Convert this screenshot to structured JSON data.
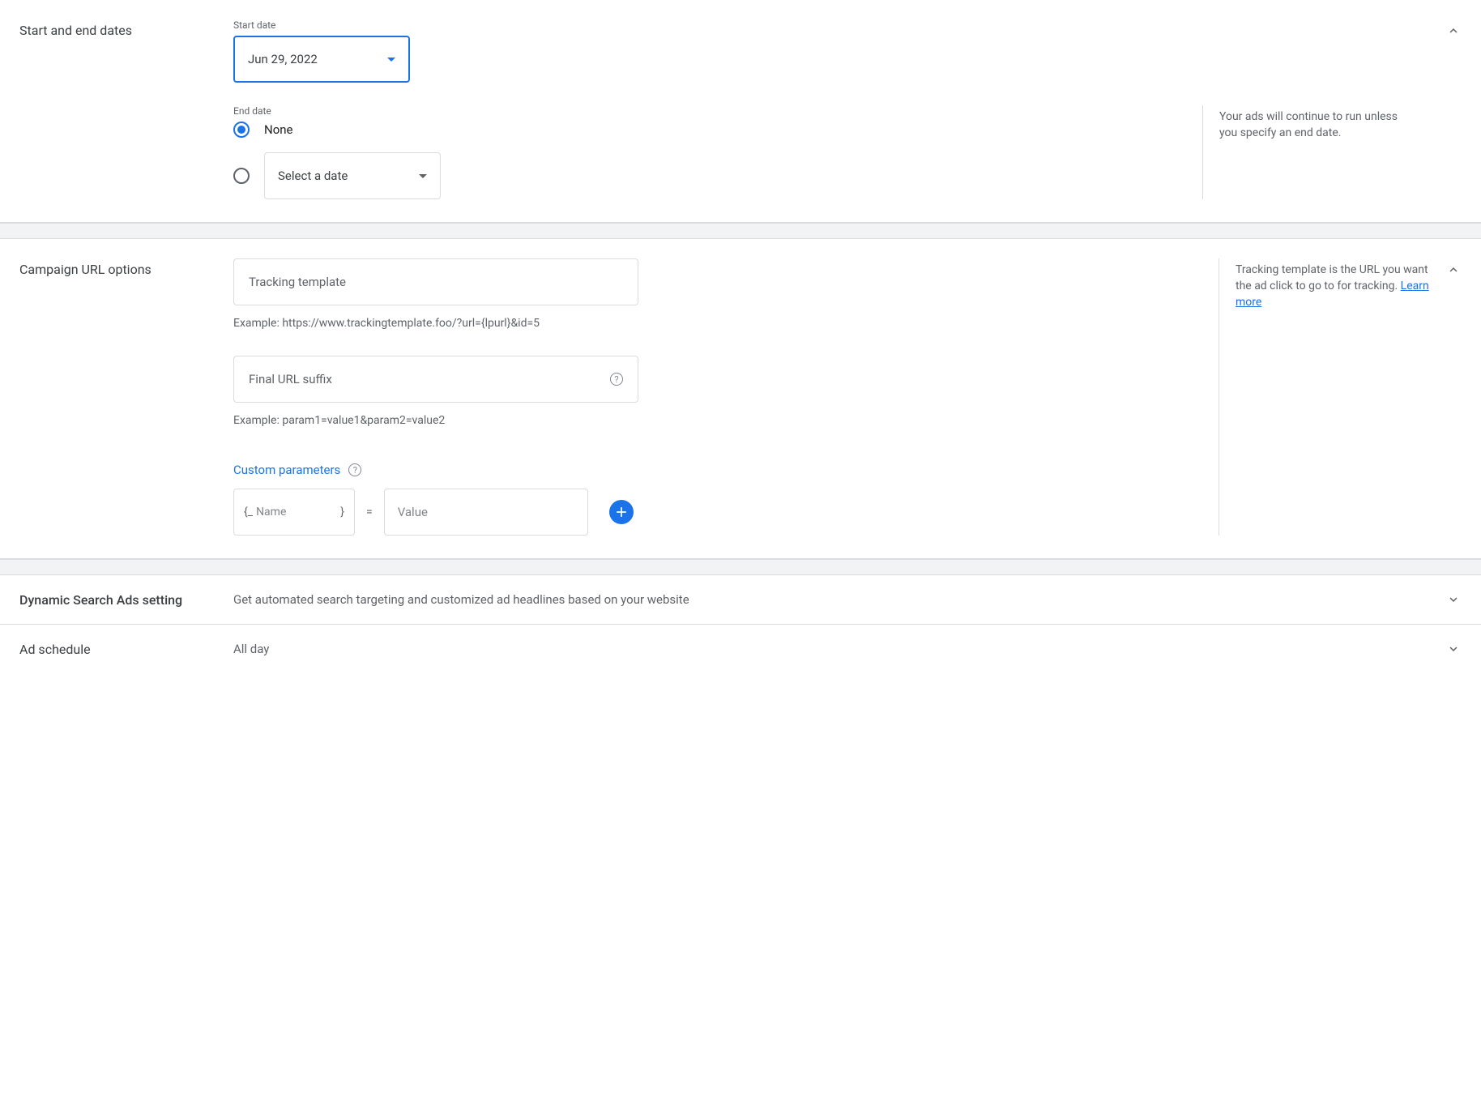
{
  "dates": {
    "section_title": "Start and end dates",
    "start_label": "Start date",
    "start_value": "Jun 29, 2022",
    "end_label": "End date",
    "end_none": "None",
    "end_placeholder": "Select a date",
    "side_text": "Your ads will continue to run unless you specify an end date."
  },
  "url": {
    "section_title": "Campaign URL options",
    "tracking_placeholder": "Tracking template",
    "tracking_example": "Example: https://www.trackingtemplate.foo/?url={lpurl}&id=5",
    "suffix_placeholder": "Final URL suffix",
    "suffix_example": "Example: param1=value1&param2=value2",
    "custom_params_label": "Custom parameters",
    "param_name_prefix": "{_",
    "param_name_placeholder": "Name",
    "param_name_suffix": "}",
    "param_eq": "=",
    "param_value_placeholder": "Value",
    "side_text": "Tracking template is the URL you want the ad click to go to for tracking. ",
    "learn_more": "Learn more"
  },
  "dsa": {
    "title": "Dynamic Search Ads setting",
    "summary": "Get automated search targeting and customized ad headlines based on your website"
  },
  "schedule": {
    "title": "Ad schedule",
    "summary": "All day"
  }
}
